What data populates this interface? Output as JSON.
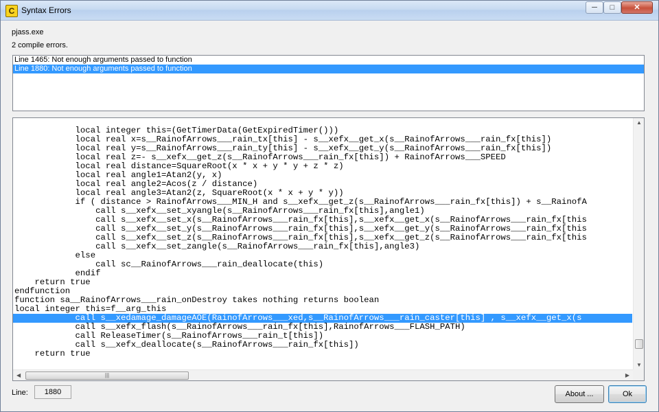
{
  "window": {
    "title": "Syntax Errors",
    "icon_glyph": "C",
    "controls": {
      "minimize": "─",
      "maximize": "□",
      "close": "✕"
    }
  },
  "header": {
    "program": "pjass.exe",
    "summary": "2 compile errors."
  },
  "errors": [
    {
      "text": "Line 1465:  Not enough arguments passed to function",
      "selected": false
    },
    {
      "text": "Line 1880:  Not enough arguments passed to function",
      "selected": true
    }
  ],
  "code_lines": [
    {
      "text": "            local integer this=(GetTimerData(GetExpiredTimer()))",
      "selected": false
    },
    {
      "text": "            local real x=s__RainofArrows___rain_tx[this] - s__xefx__get_x(s__RainofArrows___rain_fx[this])",
      "selected": false
    },
    {
      "text": "            local real y=s__RainofArrows___rain_ty[this] - s__xefx__get_y(s__RainofArrows___rain_fx[this])",
      "selected": false
    },
    {
      "text": "            local real z=- s__xefx__get_z(s__RainofArrows___rain_fx[this]) + RainofArrows___SPEED",
      "selected": false
    },
    {
      "text": "            local real distance=SquareRoot(x * x + y * y + z * z)",
      "selected": false
    },
    {
      "text": "            local real angle1=Atan2(y, x)",
      "selected": false
    },
    {
      "text": "            local real angle2=Acos(z / distance)",
      "selected": false
    },
    {
      "text": "            local real angle3=Atan2(z, SquareRoot(x * x + y * y))",
      "selected": false
    },
    {
      "text": "            if ( distance > RainofArrows___MIN_H and s__xefx__get_z(s__RainofArrows___rain_fx[this]) + s__RainofA",
      "selected": false
    },
    {
      "text": "                call s__xefx__set_xyangle(s__RainofArrows___rain_fx[this],angle1)",
      "selected": false
    },
    {
      "text": "                call s__xefx__set_x(s__RainofArrows___rain_fx[this],s__xefx__get_x(s__RainofArrows___rain_fx[this",
      "selected": false
    },
    {
      "text": "                call s__xefx__set_y(s__RainofArrows___rain_fx[this],s__xefx__get_y(s__RainofArrows___rain_fx[this",
      "selected": false
    },
    {
      "text": "                call s__xefx__set_z(s__RainofArrows___rain_fx[this],s__xefx__get_z(s__RainofArrows___rain_fx[this",
      "selected": false
    },
    {
      "text": "                call s__xefx__set_zangle(s__RainofArrows___rain_fx[this],angle3)",
      "selected": false
    },
    {
      "text": "            else",
      "selected": false
    },
    {
      "text": "                call sc__RainofArrows___rain_deallocate(this)",
      "selected": false
    },
    {
      "text": "            endif",
      "selected": false
    },
    {
      "text": "    return true",
      "selected": false
    },
    {
      "text": "endfunction",
      "selected": false
    },
    {
      "text": "function sa__RainofArrows___rain_onDestroy takes nothing returns boolean",
      "selected": false
    },
    {
      "text": "local integer this=f__arg_this",
      "selected": false
    },
    {
      "text": "            call s__xedamage_damageAOE(RainofArrows___xed,s__RainofArrows___rain_caster[this] , s__xefx__get_x(s",
      "selected": true
    },
    {
      "text": "            call s__xefx_flash(s__RainofArrows___rain_fx[this],RainofArrows___FLASH_PATH)",
      "selected": false
    },
    {
      "text": "            call ReleaseTimer(s__RainofArrows___rain_t[this])",
      "selected": false
    },
    {
      "text": "            call s__xefx_deallocate(s__RainofArrows___rain_fx[this])",
      "selected": false
    },
    {
      "text": "    return true",
      "selected": false
    }
  ],
  "footer": {
    "line_label": "Line:",
    "line_value": "1880",
    "about_label": "About ...",
    "ok_label": "Ok"
  },
  "scrollbars": {
    "up": "▲",
    "down": "▼",
    "left": "◀",
    "right": "▶",
    "grip": "|||"
  },
  "colors": {
    "selection": "#3399ff",
    "title_bar": "#c7daf1",
    "close_button": "#c8513b"
  }
}
